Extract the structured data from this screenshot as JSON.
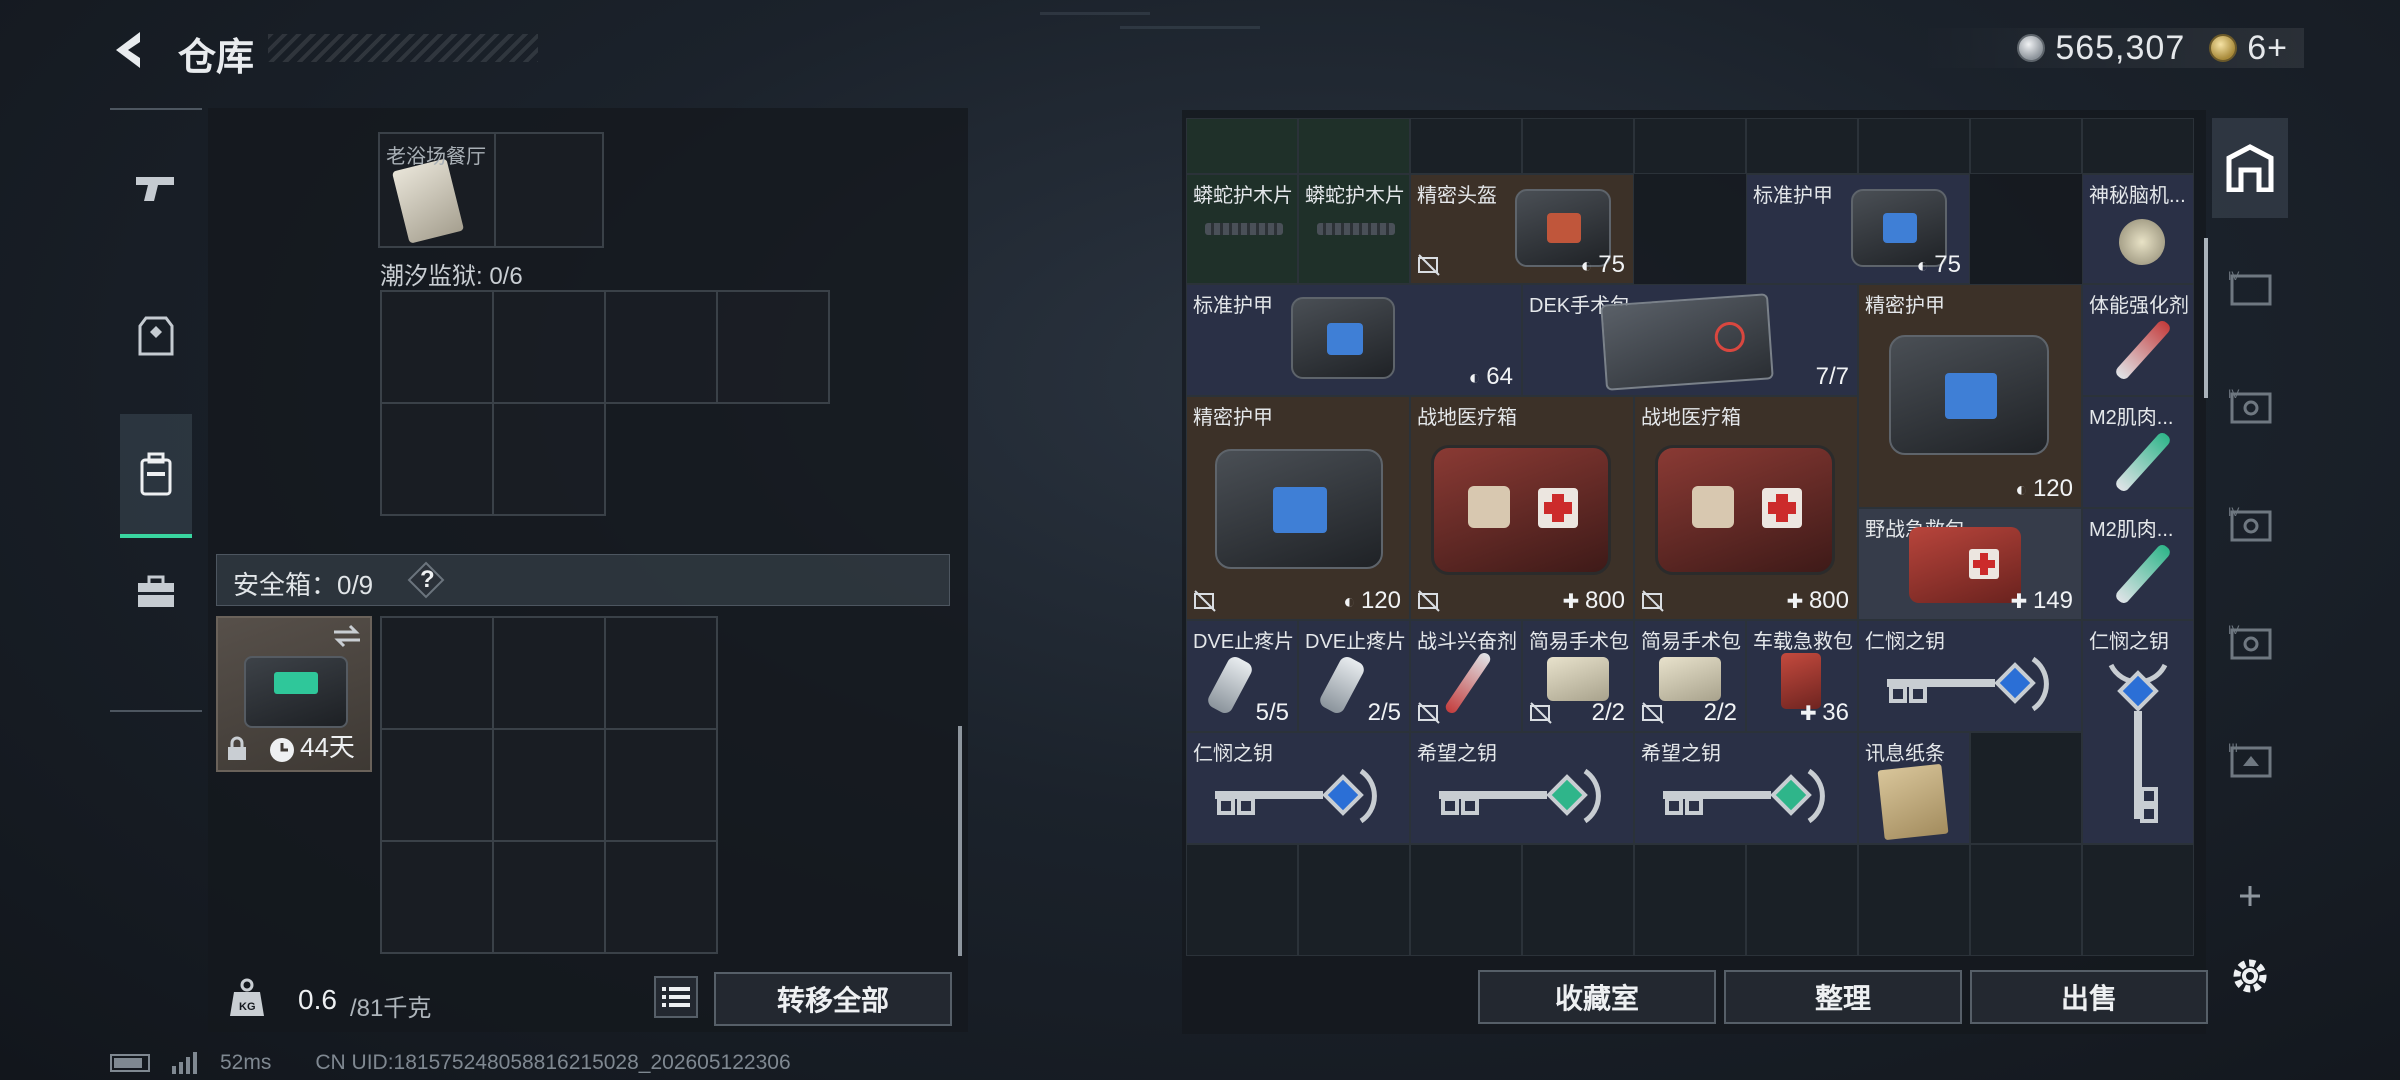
{
  "header": {
    "title": "仓库",
    "silver_amount": "565,307",
    "gold_amount": "6+"
  },
  "left_panel": {
    "top_item_label": "老浴场餐厅",
    "prison_label": "潮汐监狱: 0/6",
    "safebox_label": "安全箱：0/9",
    "safebox_help": "?",
    "safebox_timer": "44天",
    "weight_current": "0.6",
    "weight_max": "/81千克",
    "transfer_all": "转移全部"
  },
  "inventory": {
    "items": [
      {
        "name": "蟒蛇护木片",
        "count": "",
        "icon": "handguard-icon"
      },
      {
        "name": "蟒蛇护木片",
        "count": "",
        "icon": "handguard-icon"
      },
      {
        "name": "精密头盔",
        "count": "75",
        "icon": "helmet-bag-icon"
      },
      {
        "name": "标准护甲",
        "count": "75",
        "icon": "armor-bag-icon"
      },
      {
        "name": "神秘脑机...",
        "count": "",
        "icon": "brain-chip-icon"
      },
      {
        "name": "标准护甲",
        "count": "64",
        "icon": "armor-bag-icon"
      },
      {
        "name": "DEK手术包",
        "count": "7/7",
        "icon": "surgical-kit-icon"
      },
      {
        "name": "精密护甲",
        "count": "120",
        "icon": "armor-bag-icon"
      },
      {
        "name": "体能强化剂",
        "count": "",
        "icon": "injector-icon"
      },
      {
        "name": "精密护甲",
        "count": "120",
        "icon": "armor-bag-icon"
      },
      {
        "name": "战地医疗箱",
        "count": "800",
        "icon": "medkit-icon"
      },
      {
        "name": "战地医疗箱",
        "count": "800",
        "icon": "medkit-icon"
      },
      {
        "name": "M2肌肉...",
        "count": "",
        "icon": "injector-icon"
      },
      {
        "name": "野战急救包",
        "count": "149",
        "icon": "first-aid-icon"
      },
      {
        "name": "M2肌肉...",
        "count": "",
        "icon": "injector-icon"
      },
      {
        "name": "DVE止疼片",
        "count": "5/5",
        "icon": "pill-icon"
      },
      {
        "name": "DVE止疼片",
        "count": "2/5",
        "icon": "pill-icon"
      },
      {
        "name": "战斗兴奋剂",
        "count": "",
        "icon": "stim-icon"
      },
      {
        "name": "简易手术包",
        "count": "2/2",
        "icon": "pouch-icon"
      },
      {
        "name": "简易手术包",
        "count": "2/2",
        "icon": "pouch-icon"
      },
      {
        "name": "车载急救包",
        "count": "36",
        "icon": "car-medkit-icon"
      },
      {
        "name": "仁悯之钥",
        "count": "",
        "icon": "key-icon"
      },
      {
        "name": "仁悯之钥",
        "count": "",
        "icon": "key-icon"
      },
      {
        "name": "仁悯之钥",
        "count": "",
        "icon": "key-icon"
      },
      {
        "name": "希望之钥",
        "count": "",
        "icon": "key-icon"
      },
      {
        "name": "希望之钥",
        "count": "",
        "icon": "key-icon"
      },
      {
        "name": "讯息纸条",
        "count": "",
        "icon": "note-icon"
      }
    ]
  },
  "actions": {
    "collection": "收藏室",
    "sort": "整理",
    "sell": "出售"
  },
  "footer": {
    "ping": "52ms",
    "uid": "CN UID:1815752480588162150​28_202605122306"
  },
  "colors": {
    "accent": "#39d6a0",
    "panel": "#14181e"
  }
}
